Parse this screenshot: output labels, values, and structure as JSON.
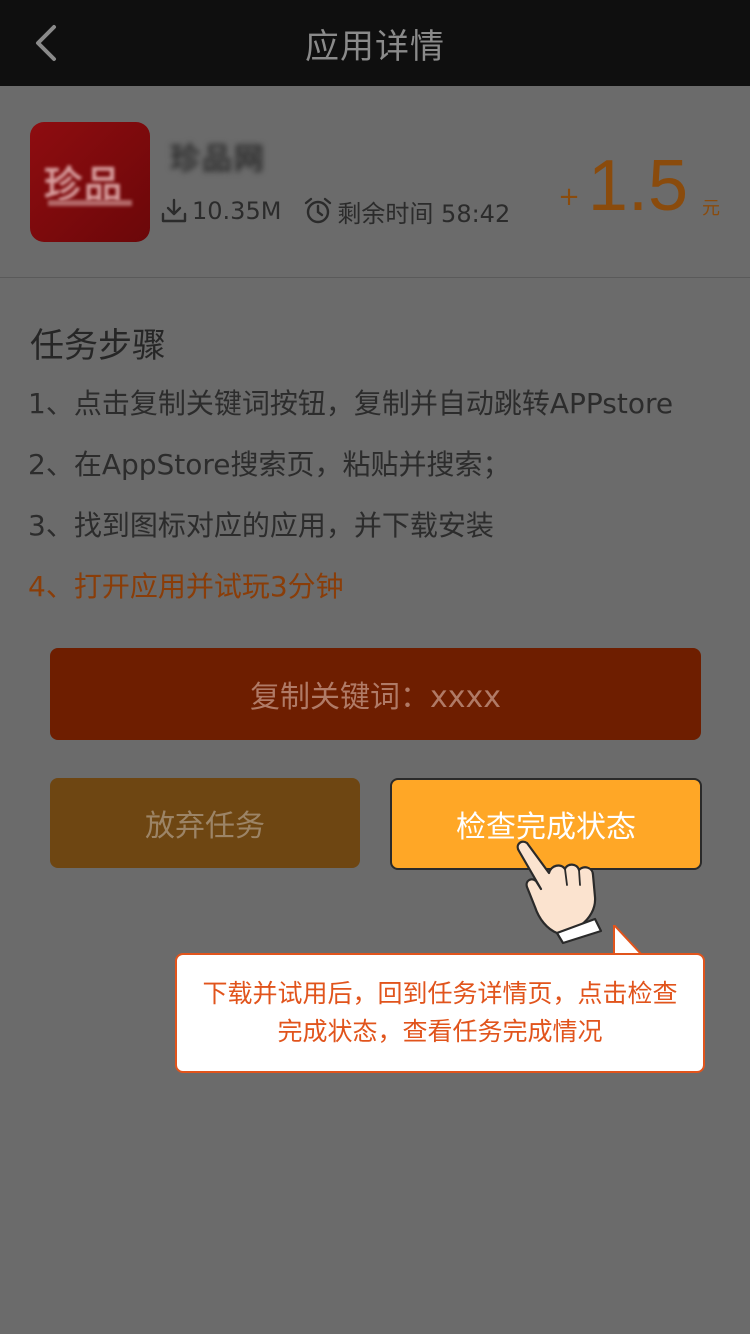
{
  "nav": {
    "title": "应用详情",
    "back_icon": "chevron-left-icon"
  },
  "app": {
    "icon_text": "珍品",
    "name": "珍品网",
    "size": "10.35M",
    "remaining_label": "剩余时间 58:42",
    "reward_plus": "+",
    "reward_amount": "1.5",
    "reward_unit": "元"
  },
  "steps": {
    "title": "任务步骤",
    "items": [
      "1、点击复制关键词按钮，复制并自动跳转APPstore",
      "2、在AppStore搜索页，粘贴并搜索；",
      "3、找到图标对应的应用，并下载安装",
      "4、打开应用并试玩3分钟"
    ]
  },
  "buttons": {
    "copy": "复制关键词：xxxx",
    "abandon": "放弃任务",
    "check": "检查完成状态"
  },
  "tooltip": {
    "text": "下载并试用后，回到任务详情页，点击检查完成状态，查看任务完成情况"
  },
  "colors": {
    "overlay": "#6b6b6b",
    "reward": "#8a4b0c",
    "check_button": "#ffa726",
    "tooltip_accent": "#e1541c"
  }
}
